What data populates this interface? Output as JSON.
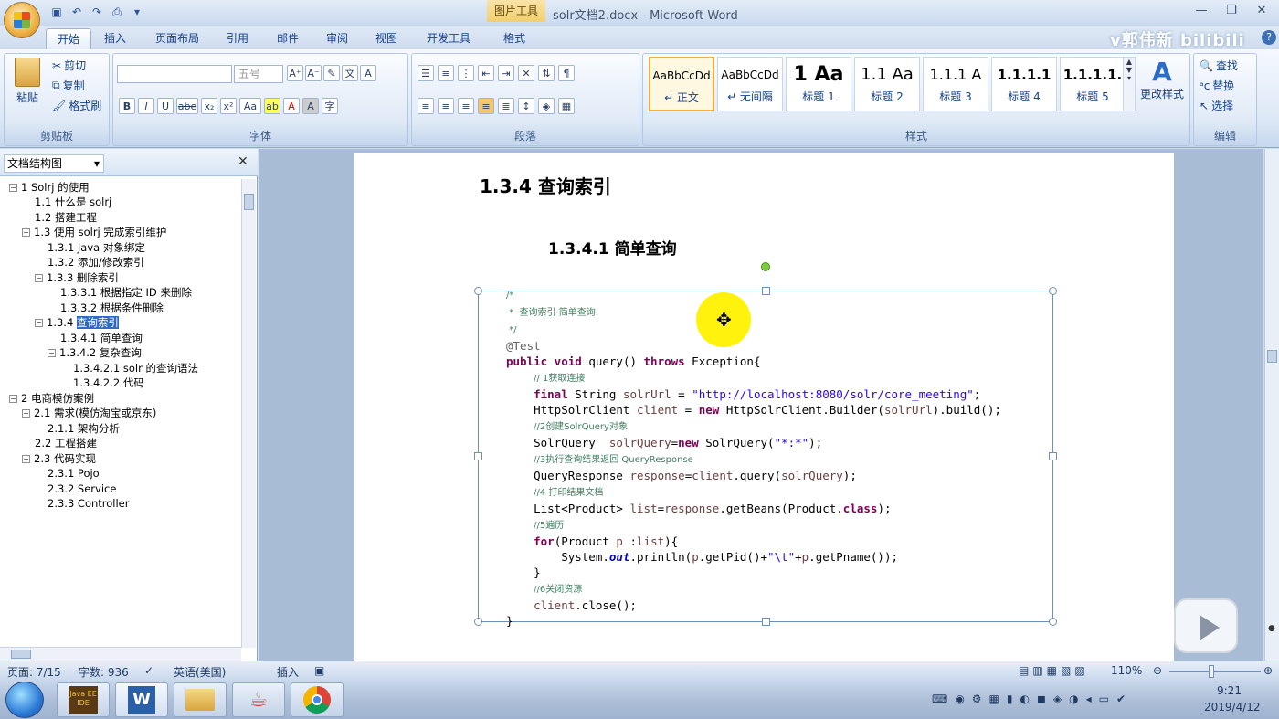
{
  "window": {
    "title": "solr文档2.docx - Microsoft Word",
    "context_tab": "图片工具",
    "watermark": "v郭伟新 bilibili"
  },
  "ribbon_tabs": [
    "开始",
    "插入",
    "页面布局",
    "引用",
    "邮件",
    "审阅",
    "视图",
    "开发工具",
    "格式"
  ],
  "ribbon": {
    "clipboard": {
      "paste": "粘贴",
      "cut": "剪切",
      "copy": "复制",
      "format_painter": "格式刷",
      "label": "剪贴板"
    },
    "font": {
      "font_size": "五号",
      "label": "字体"
    },
    "paragraph": {
      "label": "段落"
    },
    "styles": {
      "label": "样式",
      "cards": [
        {
          "preview": "AaBbCcDd",
          "name": "↵ 正文"
        },
        {
          "preview": "AaBbCcDd",
          "name": "↵ 无间隔"
        },
        {
          "preview": "1  Aa",
          "name": "标题 1"
        },
        {
          "preview": "1.1  Aa",
          "name": "标题 2"
        },
        {
          "preview": "1.1.1  A",
          "name": "标题 3"
        },
        {
          "preview": "1.1.1.1",
          "name": "标题 4"
        },
        {
          "preview": "1.1.1.1.",
          "name": "标题 5"
        }
      ],
      "change_styles": "更改样式"
    },
    "editing": {
      "find": "查找",
      "replace": "替换",
      "select": "选择",
      "label": "编辑"
    }
  },
  "nav_pane": {
    "selector": "文档结构图",
    "tree": [
      {
        "toggle": "⊟",
        "text": "1 Solrj 的使用"
      },
      {
        "toggle": "",
        "text": "1.1 什么是 solrj"
      },
      {
        "toggle": "",
        "text": "1.2 搭建工程"
      },
      {
        "toggle": "⊟",
        "text": "1.3 使用 solrj 完成索引维护"
      },
      {
        "toggle": "",
        "text": "1.3.1 Java 对象绑定"
      },
      {
        "toggle": "",
        "text": "1.3.2 添加/修改索引"
      },
      {
        "toggle": "⊟",
        "text": "1.3.3 删除索引"
      },
      {
        "toggle": "",
        "text": "1.3.3.1 根据指定 ID 来删除"
      },
      {
        "toggle": "",
        "text": "1.3.3.2 根据条件删除"
      },
      {
        "toggle": "⊟",
        "prefix": "1.3.4 ",
        "text": "查询索引"
      },
      {
        "toggle": "",
        "text": "1.3.4.1 简单查询"
      },
      {
        "toggle": "⊟",
        "text": "1.3.4.2 复杂查询"
      },
      {
        "toggle": "",
        "text": "1.3.4.2.1 solr 的查询语法"
      },
      {
        "toggle": "",
        "text": "1.3.4.2.2 代码"
      },
      {
        "toggle": "⊟",
        "text": "2 电商模仿案例"
      },
      {
        "toggle": "⊟",
        "text": "2.1 需求(模仿淘宝或京东)"
      },
      {
        "toggle": "",
        "text": "2.1.1 架构分析"
      },
      {
        "toggle": "",
        "text": "2.2 工程搭建"
      },
      {
        "toggle": "⊟",
        "text": "2.3 代码实现"
      },
      {
        "toggle": "",
        "text": "2.3.1 Pojo"
      },
      {
        "toggle": "",
        "text": "2.3.2 Service"
      },
      {
        "toggle": "",
        "text": "2.3.3 Controller"
      }
    ]
  },
  "document": {
    "heading_134": "1.3.4 查询索引",
    "heading_1341": "1.3.4.1 简单查询"
  },
  "status": {
    "page": "页面: 7/15",
    "words": "字数: 936",
    "language": "英语(美国)",
    "insert": "插入",
    "zoom": "110%"
  },
  "taskbar": {
    "time": "9:21",
    "date": "2019/4/12",
    "apps": [
      "Java EE IDE",
      "Word",
      "文件资源管理器",
      "Java",
      "Chrome"
    ]
  }
}
